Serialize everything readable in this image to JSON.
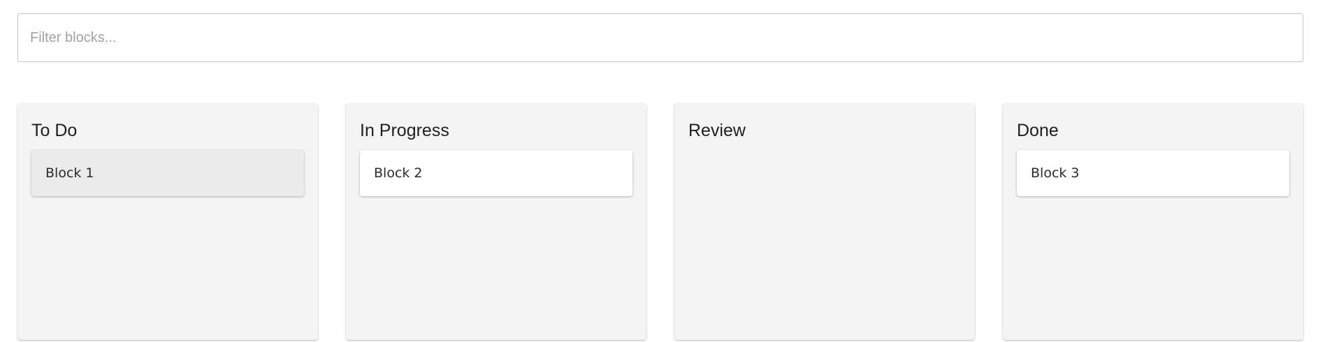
{
  "filter": {
    "placeholder": "Filter blocks...",
    "value": ""
  },
  "columns": [
    {
      "title": "To Do",
      "blocks": [
        {
          "label": "Block 1",
          "highlighted": true
        }
      ]
    },
    {
      "title": "In Progress",
      "blocks": [
        {
          "label": "Block 2",
          "highlighted": false
        }
      ]
    },
    {
      "title": "Review",
      "blocks": []
    },
    {
      "title": "Done",
      "blocks": [
        {
          "label": "Block 3",
          "highlighted": false
        }
      ]
    }
  ],
  "colors": {
    "column_background": "#f4f4f4",
    "card_background": "#ffffff",
    "card_highlight": "#ebebeb",
    "input_border": "#c4c4c4"
  }
}
